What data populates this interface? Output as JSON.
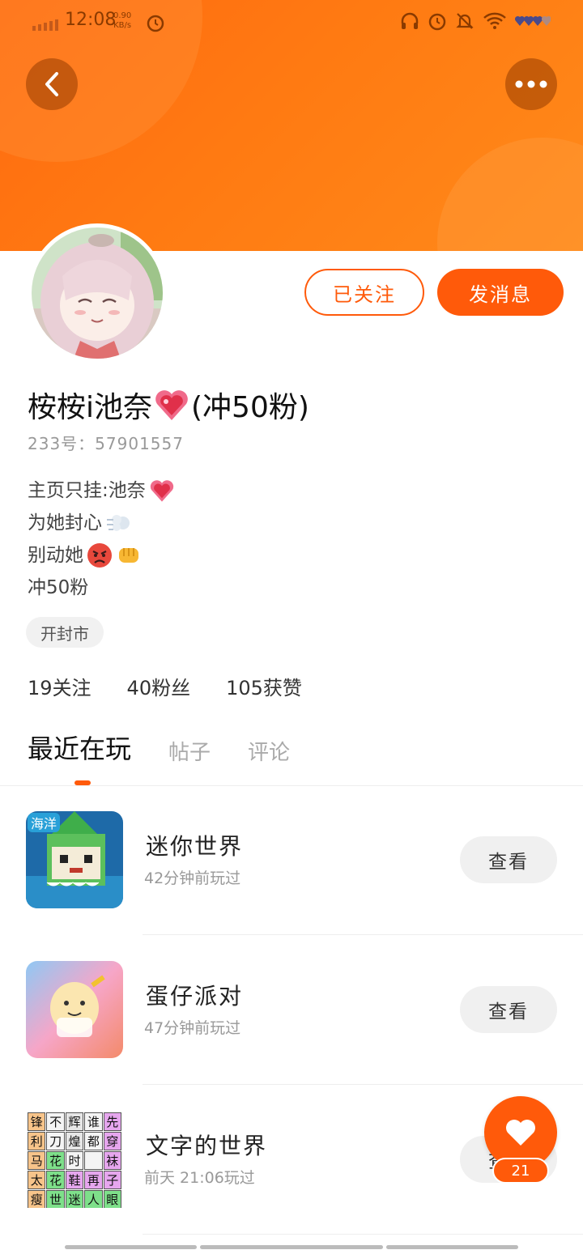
{
  "status_bar": {
    "time": "12:08",
    "speed_value": "0.90",
    "speed_unit": "KB/s"
  },
  "colors": {
    "accent": "#ff5a0a",
    "header_gradient": [
      "#ff6a10",
      "#ff8a1a"
    ]
  },
  "header": {
    "back_icon": "back-arrow-icon",
    "more_icon": "more-dots-icon"
  },
  "profile": {
    "follow_label": "已关注",
    "message_label": "发消息",
    "username_prefix": "桉桉i池奈",
    "username_suffix": "(冲50粉)",
    "user_id": "233号：57901557",
    "bio": [
      "主页只挂:池奈",
      "为她封心",
      "别动她",
      "冲50粉"
    ],
    "location": "开封市",
    "stats": [
      "19关注",
      "40粉丝",
      "105获赞"
    ]
  },
  "tabs": [
    "最近在玩",
    "帖子",
    "评论"
  ],
  "games": [
    {
      "name": "迷你世界",
      "time": "42分钟前玩过",
      "action": "查看"
    },
    {
      "name": "蛋仔派对",
      "time": "47分钟前玩过",
      "action": "查看"
    },
    {
      "name": "文字的世界",
      "time": "前天 21:06玩过",
      "action": "查看"
    }
  ],
  "word_grid": [
    "锋",
    "不",
    "辉",
    "谁",
    "先",
    "利",
    "刀",
    "煌",
    "都",
    "穿",
    "马",
    "花",
    "时",
    "",
    "袜",
    "太",
    "花",
    "鞋",
    "再",
    "子",
    "瘦",
    "世",
    "迷",
    "人",
    "眼"
  ],
  "like_count": "21",
  "mini_world_badge": "海洋"
}
